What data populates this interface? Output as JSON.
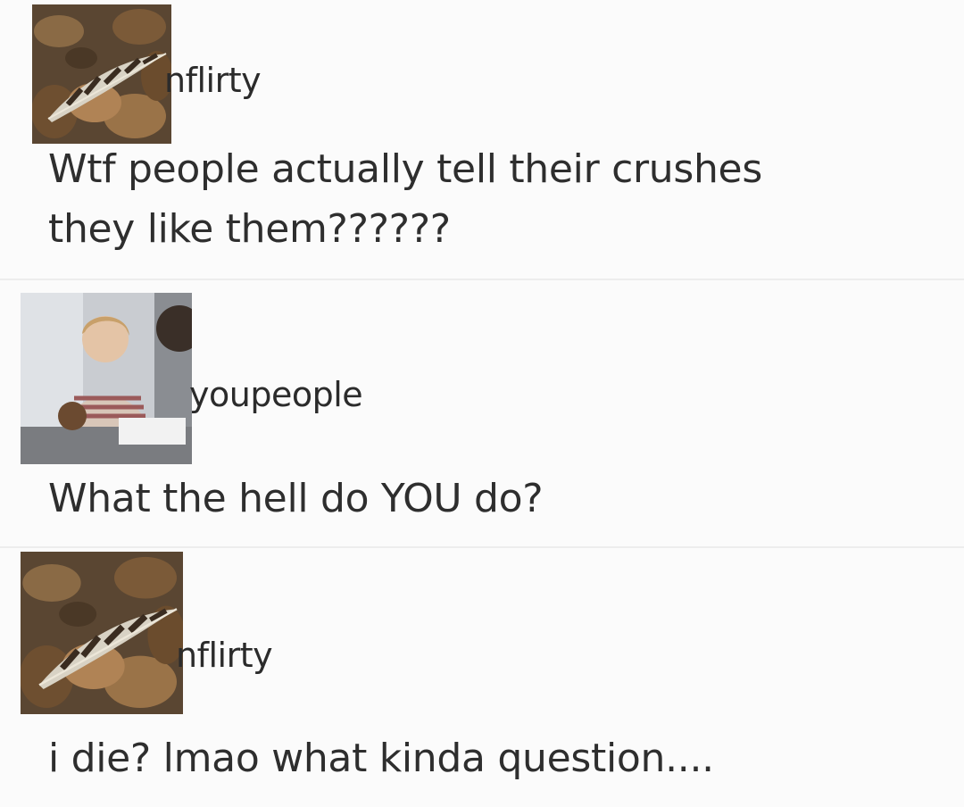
{
  "posts": [
    {
      "avatar_icon": "feather-leaves-avatar-icon",
      "username": "nflirty",
      "message": "Wtf people actually tell their crushes\nthey like them??????"
    },
    {
      "avatar_icon": "person-photo-avatar-icon",
      "username": "youpeople",
      "message": "What the hell do YOU do?"
    },
    {
      "avatar_icon": "feather-leaves-avatar-icon",
      "username": "nflirty",
      "message": "i die? lmao what kinda question...."
    }
  ]
}
